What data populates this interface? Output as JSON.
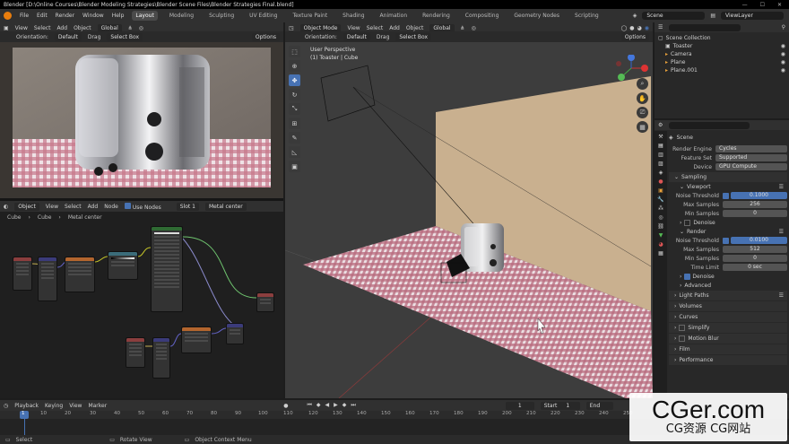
{
  "title": "Blender [D:\\Online Courses\\Blender Modeling Strategies\\Blender Scene Files\\Blender Strategies Final.blend]",
  "menu": [
    "File",
    "Edit",
    "Render",
    "Window",
    "Help"
  ],
  "workspaces": [
    "Layout",
    "Modeling",
    "Sculpting",
    "UV Editing",
    "Texture Paint",
    "Shading",
    "Animation",
    "Rendering",
    "Compositing",
    "Geometry Nodes",
    "Scripting"
  ],
  "scene_name": "Scene",
  "view_layer": "ViewLayer",
  "render_view": {
    "menu": [
      "View",
      "Select",
      "Add",
      "Object"
    ],
    "global": "Global",
    "orientation_label": "Orientation:",
    "orientation": "Default",
    "drag_label": "Drag",
    "select_box": "Select Box",
    "options": "Options"
  },
  "node_editor": {
    "mode": "Object",
    "menu": [
      "View",
      "Select",
      "Add",
      "Node"
    ],
    "use_nodes": "Use Nodes",
    "slot": "Slot 1",
    "material": "Metal center",
    "breadcrumb": [
      "Cube",
      "Cube",
      "Metal center"
    ]
  },
  "viewport": {
    "mode": "Object Mode",
    "menu": [
      "View",
      "Select",
      "Add",
      "Object"
    ],
    "global": "Global",
    "orientation_label": "Orientation:",
    "orientation": "Default",
    "drag_label": "Drag",
    "select_box": "Select Box",
    "options": "Options",
    "info_line1": "User Perspective",
    "info_line2": "(1) Toaster | Cube"
  },
  "outliner": {
    "root": "Scene Collection",
    "items": [
      "Toaster",
      "Camera",
      "Plane",
      "Plane.001"
    ]
  },
  "properties": {
    "scene_label": "Scene",
    "render_engine_label": "Render Engine",
    "render_engine": "Cycles",
    "feature_set_label": "Feature Set",
    "feature_set": "Supported",
    "device_label": "Device",
    "device": "GPU Compute",
    "sampling": "Sampling",
    "viewport": "Viewport",
    "noise_threshold_label": "Noise Threshold",
    "viewport_noise_threshold": "0.1000",
    "max_samples_label": "Max Samples",
    "viewport_max_samples": "256",
    "min_samples_label": "Min Samples",
    "viewport_min_samples": "0",
    "denoise": "Denoise",
    "render": "Render",
    "render_noise_threshold": "0.0100",
    "render_max_samples": "512",
    "render_min_samples": "0",
    "time_limit_label": "Time Limit",
    "time_limit": "0 sec",
    "render_denoise": "Denoise",
    "advanced": "Advanced",
    "sections": [
      "Light Paths",
      "Volumes",
      "Curves",
      "Simplify",
      "Motion Blur",
      "Film",
      "Performance"
    ]
  },
  "timeline": {
    "menu": [
      "Playback",
      "Keying",
      "View",
      "Marker"
    ],
    "current_frame": "1",
    "start_label": "Start",
    "start": "1",
    "end_label": "End",
    "ticks": [
      "1",
      "10",
      "20",
      "30",
      "40",
      "50",
      "60",
      "70",
      "80",
      "90",
      "100",
      "110",
      "120",
      "130",
      "140",
      "150",
      "160",
      "170",
      "180",
      "190",
      "200",
      "210",
      "220",
      "230",
      "240",
      "250"
    ]
  },
  "status": {
    "select": "Select",
    "rotate": "Rotate View",
    "context": "Object Context Menu"
  },
  "watermark": {
    "main": "CGer.com",
    "sub": "CG资源 CG网站"
  },
  "colors": {
    "accent": "#4772b3",
    "blender_orange": "#e87d0d",
    "wall": "#c9b08f",
    "cloth": "#b8707f"
  }
}
